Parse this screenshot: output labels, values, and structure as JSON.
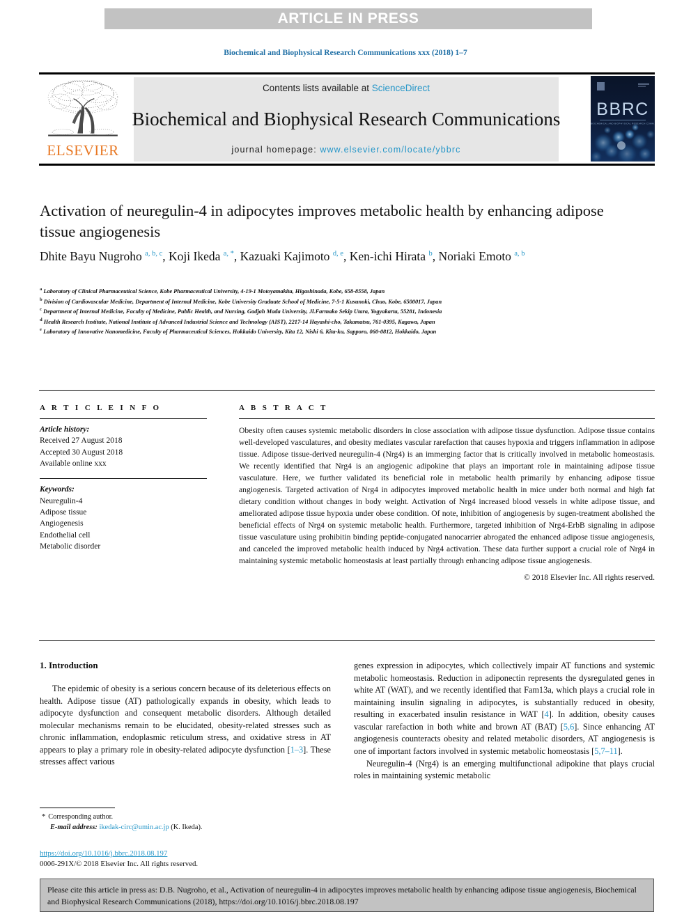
{
  "banner": {
    "text": "ARTICLE IN PRESS"
  },
  "running_head": "Biochemical and Biophysical Research Communications xxx (2018) 1–7",
  "masthead": {
    "publisher": "ELSEVIER",
    "contents_prefix": "Contents lists available at ",
    "contents_link": "ScienceDirect",
    "journal_title": "Biochemical and Biophysical Research Communications",
    "homepage_label": "journal homepage: ",
    "homepage_url": "www.elsevier.com/locate/ybbrc",
    "cover_title": "BBRC",
    "cover_sub": "BIOCHEMICAL AND BIOPHYSICAL RESEARCH COMMUNICATIONS"
  },
  "article": {
    "title": "Activation of neuregulin-4 in adipocytes improves metabolic health by enhancing adipose tissue angiogenesis",
    "authors_html": "Dhite Bayu Nugroho <sup>a, b, c</sup>, Koji Ikeda <sup>a, *</sup>, Kazuaki Kajimoto <sup>d, e</sup>, Ken-ichi Hirata <sup>b</sup>, Noriaki Emoto <sup>a, b</sup>",
    "affiliations": [
      {
        "marker": "a",
        "text": "Laboratory of Clinical Pharmaceutical Science, Kobe Pharmaceutical University, 4-19-1 Motoyamakita, Higashinada, Kobe, 658-8558, Japan"
      },
      {
        "marker": "b",
        "text": "Division of Cardiovascular Medicine, Department of Internal Medicine, Kobe University Graduate School of Medicine, 7-5-1 Kusunoki, Chuo, Kobe, 6500017, Japan"
      },
      {
        "marker": "c",
        "text": "Department of Internal Medicine, Faculty of Medicine, Public Health, and Nursing, Gadjah Mada University, Jl.Farmako Sekip Utara, Yogyakarta, 55281, Indonesia"
      },
      {
        "marker": "d",
        "text": "Health Research Institute, National Institute of Advanced Industrial Science and Technology (AIST), 2217-14 Hayashi-cho, Takamatsu, 761-0395, Kagawa, Japan"
      },
      {
        "marker": "e",
        "text": "Laboratory of Innovative Nanomedicine, Faculty of Pharmaceutical Sciences, Hokkaido University, Kita 12, Nishi 6, Kita-ku, Sapporo, 060-0812, Hokkaido, Japan"
      }
    ]
  },
  "article_info": {
    "heading": "A R T I C L E   I N F O",
    "history_label": "Article history:",
    "history": [
      "Received 27 August 2018",
      "Accepted 30 August 2018",
      "Available online xxx"
    ],
    "keywords_label": "Keywords:",
    "keywords": [
      "Neuregulin-4",
      "Adipose tissue",
      "Angiogenesis",
      "Endothelial cell",
      "Metabolic disorder"
    ]
  },
  "abstract": {
    "heading": "A B S T R A C T",
    "body": "Obesity often causes systemic metabolic disorders in close association with adipose tissue dysfunction. Adipose tissue contains well-developed vasculatures, and obesity mediates vascular rarefaction that causes hypoxia and triggers inflammation in adipose tissue. Adipose tissue-derived neuregulin-4 (Nrg4) is an immerging factor that is critically involved in metabolic homeostasis. We recently identified that Nrg4 is an angiogenic adipokine that plays an important role in maintaining adipose tissue vasculature. Here, we further validated its beneficial role in metabolic health primarily by enhancing adipose tissue angiogenesis. Targeted activation of Nrg4 in adipocytes improved metabolic health in mice under both normal and high fat dietary condition without changes in body weight. Activation of Nrg4 increased blood vessels in white adipose tissue, and ameliorated adipose tissue hypoxia under obese condition. Of note, inhibition of angiogenesis by sugen-treatment abolished the beneficial effects of Nrg4 on systemic metabolic health. Furthermore, targeted inhibition of Nrg4-ErbB signaling in adipose tissue vasculature using prohibitin binding peptide-conjugated nanocarrier abrogated the enhanced adipose tissue angiogenesis, and canceled the improved metabolic health induced by Nrg4 activation. These data further support a crucial role of Nrg4 in maintaining systemic metabolic homeostasis at least partially through enhancing adipose tissue angiogenesis.",
    "copyright": "© 2018 Elsevier Inc. All rights reserved."
  },
  "introduction": {
    "heading": "1.  Introduction",
    "left_para_1_pre": "The epidemic of obesity is a serious concern because of its deleterious effects on health. Adipose tissue (AT) pathologically expands in obesity, which leads to adipocyte dysfunction and consequent metabolic disorders. Although detailed molecular mechanisms remain to be elucidated, obesity-related stresses such as chronic inflammation, endoplasmic reticulum stress, and oxidative stress in AT appears to play a primary role in obesity-related adipocyte dysfunction [",
    "left_ref_1": "1–3",
    "left_para_1_post": "]. These stresses affect various",
    "right_para_1_a": "genes expression in adipocytes, which collectively impair AT functions and systemic metabolic homeostasis. Reduction in adiponectin represents the dysregulated genes in white AT (WAT), and we recently identified that Fam13a, which plays a crucial role in maintaining insulin signaling in adipocytes, is substantially reduced in obesity, resulting in exacerbated insulin resistance in WAT [",
    "right_ref_4": "4",
    "right_para_1_b": "]. In addition, obesity causes vascular rarefaction in both white and brown AT (BAT) [",
    "right_ref_56": "5,6",
    "right_para_1_c": "]. Since enhancing AT angiogenesis counteracts obesity and related metabolic disorders, AT angiogenesis is one of important factors involved in systemic metabolic homeostasis [",
    "right_ref_5711": "5,7–11",
    "right_para_1_d": "].",
    "right_para_2": "Neuregulin-4 (Nrg4) is an emerging multifunctional adipokine that plays crucial roles in maintaining systemic metabolic"
  },
  "footnote": {
    "corresponding": "Corresponding author.",
    "email_label": "E-mail address:",
    "email": "ikedak-circ@umin.ac.jp",
    "email_owner": "(K. Ikeda).",
    "doi": "https://doi.org/10.1016/j.bbrc.2018.08.197",
    "issn_line": "0006-291X/© 2018 Elsevier Inc. All rights reserved."
  },
  "cite_box": {
    "text": "Please cite this article in press as: D.B. Nugroho, et al., Activation of neuregulin-4 in adipocytes improves metabolic health by enhancing adipose tissue angiogenesis, Biochemical and Biophysical Research Communications (2018), https://doi.org/10.1016/j.bbrc.2018.08.197"
  },
  "colors": {
    "link_blue": "#2596c8",
    "running_head_blue": "#1f6fa5",
    "elsevier_orange": "#E87722",
    "banner_gray": "#c2c2c2",
    "band_gray": "#e6e6e6",
    "cover_navy": "#0c1830"
  }
}
